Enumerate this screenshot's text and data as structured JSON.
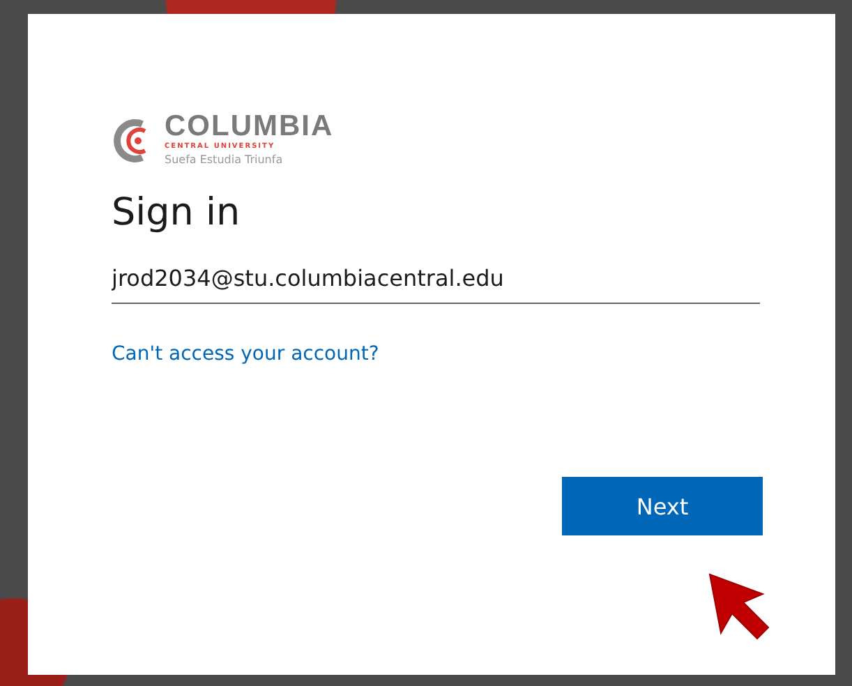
{
  "logo": {
    "name": "COLUMBIA",
    "subtitle": "CENTRAL UNIVERSITY",
    "motto": "Suefa Estudia Triunfa"
  },
  "title": "Sign in",
  "email_field": {
    "value": "jrod2034@stu.columbiacentral.edu"
  },
  "help_link": "Can't access your account?",
  "next_button": "Next"
}
